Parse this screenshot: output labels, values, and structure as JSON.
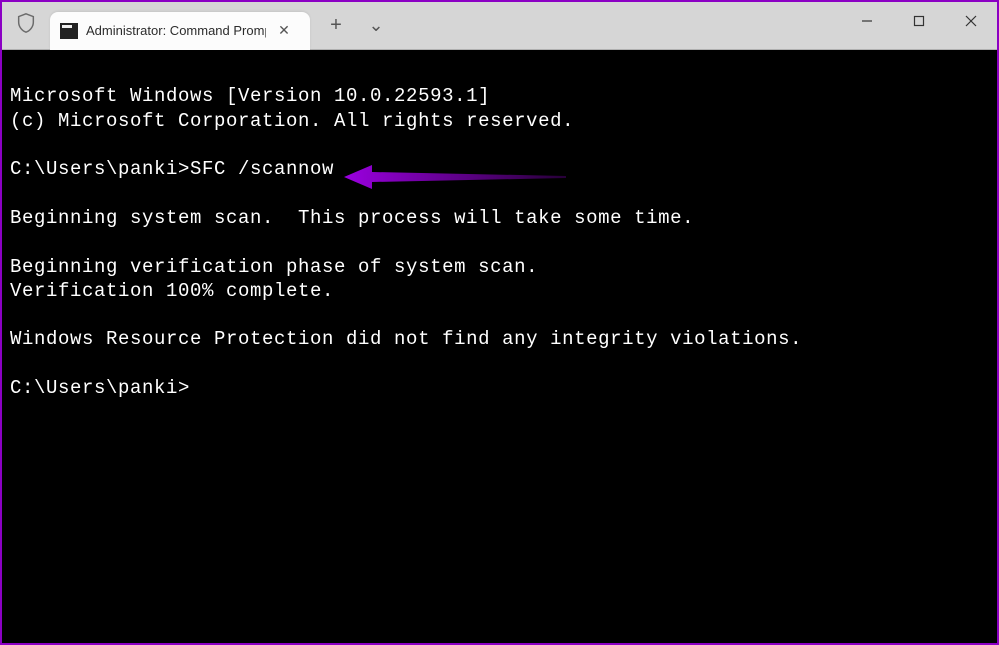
{
  "titlebar": {
    "tab_title": "Administrator: Command Promp",
    "close_glyph": "✕",
    "new_tab_glyph": "+",
    "tabs_dropdown_glyph": "⌄"
  },
  "window_controls": {
    "minimize": "minimize",
    "maximize": "maximize",
    "close": "close"
  },
  "terminal": {
    "line1": "Microsoft Windows [Version 10.0.22593.1]",
    "line2": "(c) Microsoft Corporation. All rights reserved.",
    "blank1": "",
    "prompt1_prefix": "C:\\Users\\panki>",
    "prompt1_cmd": "SFC /scannow",
    "blank2": "",
    "line3": "Beginning system scan.  This process will take some time.",
    "blank3": "",
    "line4": "Beginning verification phase of system scan.",
    "line5": "Verification 100% complete.",
    "blank4": "",
    "line6": "Windows Resource Protection did not find any integrity violations.",
    "blank5": "",
    "prompt2": "C:\\Users\\panki>"
  },
  "annotation": {
    "color": "#9b00e0"
  }
}
